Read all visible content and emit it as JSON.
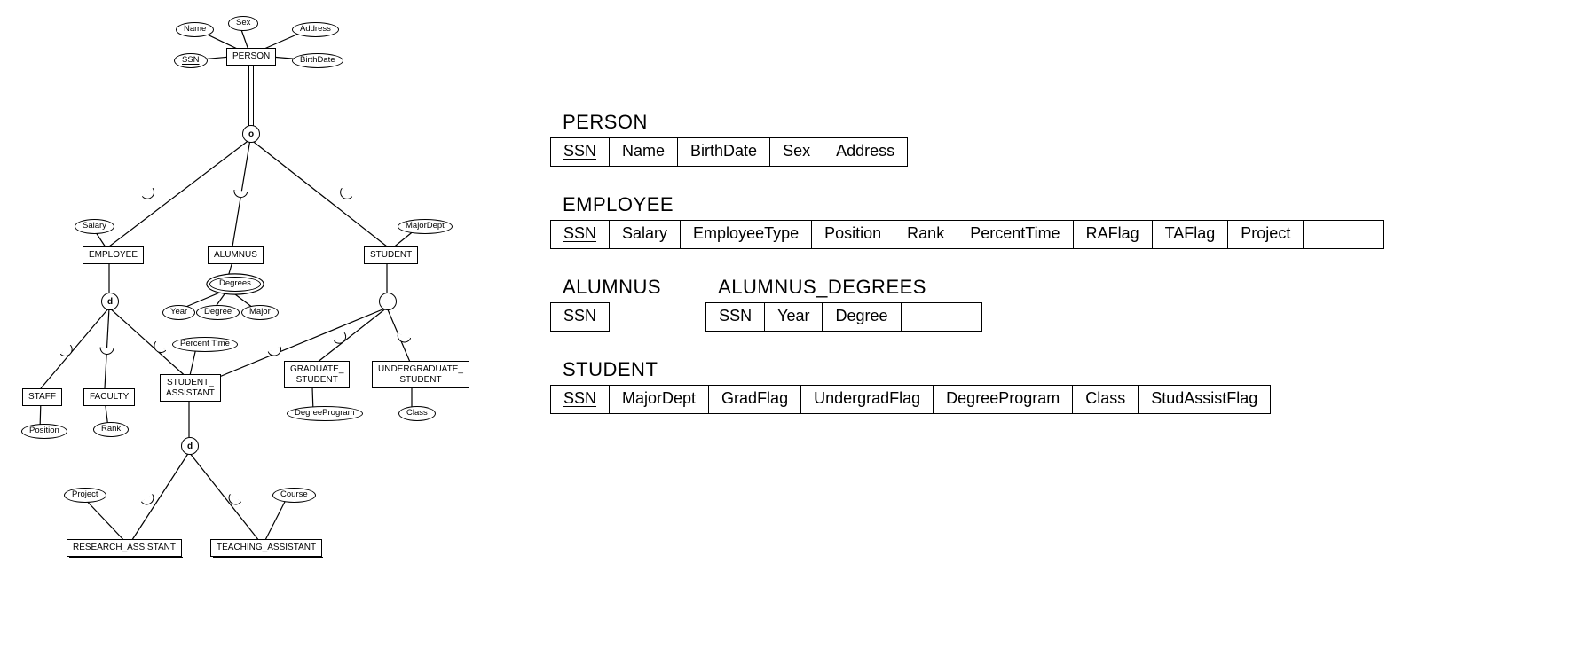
{
  "schema": {
    "person": {
      "title": "PERSON",
      "cols": [
        "SSN",
        "Name",
        "BirthDate",
        "Sex",
        "Address"
      ],
      "key": 0
    },
    "employee": {
      "title": "EMPLOYEE",
      "cols": [
        "SSN",
        "Salary",
        "EmployeeType",
        "Position",
        "Rank",
        "PercentTime",
        "RAFlag",
        "TAFlag",
        "Project",
        ""
      ],
      "key": 0
    },
    "alumnus": {
      "title": "ALUMNUS",
      "cols": [
        "SSN"
      ],
      "key": 0
    },
    "alumnus_degrees": {
      "title": "ALUMNUS_DEGREES",
      "cols": [
        "SSN",
        "Year",
        "Degree",
        ""
      ],
      "key": 0
    },
    "student": {
      "title": "STUDENT",
      "cols": [
        "SSN",
        "MajorDept",
        "GradFlag",
        "UndergradFlag",
        "DegreeProgram",
        "Class",
        "StudAssistFlag"
      ],
      "key": 0
    }
  },
  "eer": {
    "person": {
      "label": "PERSON",
      "attrs": {
        "ssn": "SSN",
        "name": "Name",
        "sex": "Sex",
        "address": "Address",
        "birthdate": "BirthDate"
      }
    },
    "employee": {
      "label": "EMPLOYEE",
      "attrs": {
        "salary": "Salary"
      }
    },
    "alumnus": {
      "label": "ALUMNUS",
      "attrs": {
        "degrees": "Degrees",
        "year": "Year",
        "degree": "Degree",
        "major": "Major"
      }
    },
    "student": {
      "label": "STUDENT",
      "attrs": {
        "majordept": "MajorDept"
      }
    },
    "staff": {
      "label": "STAFF",
      "attrs": {
        "position": "Position"
      }
    },
    "faculty": {
      "label": "FACULTY",
      "attrs": {
        "rank": "Rank"
      }
    },
    "student_assistant": {
      "label": "STUDENT_\nASSISTANT",
      "attrs": {
        "percenttime": "Percent Time"
      }
    },
    "graduate_student": {
      "label": "GRADUATE_\nSTUDENT",
      "attrs": {
        "degreeprogram": "DegreeProgram"
      }
    },
    "undergraduate_student": {
      "label": "UNDERGRADUATE_\nSTUDENT",
      "attrs": {
        "class": "Class"
      }
    },
    "research_assistant": {
      "label": "RESEARCH_ASSISTANT",
      "attrs": {
        "project": "Project"
      }
    },
    "teaching_assistant": {
      "label": "TEACHING_ASSISTANT",
      "attrs": {
        "course": "Course"
      }
    },
    "spec": {
      "o": "o",
      "d": "d"
    }
  }
}
